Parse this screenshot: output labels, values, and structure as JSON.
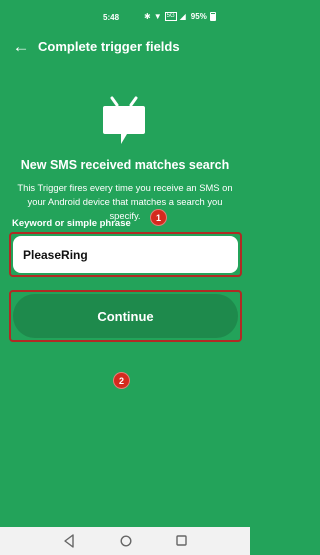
{
  "status_bar": {
    "time": "5:48",
    "bluetooth_glyph": "✱",
    "wifi_glyph": "▼",
    "signal_glyph": "◢",
    "network_label": "5G",
    "battery_percent": "95%",
    "battery_level": 0.95
  },
  "app_bar": {
    "back_icon": "arrow-left-icon",
    "back_glyph": "←",
    "title": "Complete trigger fields"
  },
  "trigger": {
    "service_icon": "sms-icon",
    "heading": "New SMS received matches search",
    "description": "This Trigger fires every time you receive an SMS on your Android device that matches a search you specify."
  },
  "field": {
    "label": "Keyword or simple phrase",
    "value": "PleaseRing",
    "annotation": "1"
  },
  "continue": {
    "label": "Continue",
    "annotation": "2"
  },
  "colors": {
    "background": "#23a35a",
    "button": "#1e8a4c",
    "annotation_red": "#d42a1e",
    "nav_bar": "#f2f2f2"
  },
  "nav_bar": {
    "items": [
      "back-triangle-icon",
      "home-circle-icon",
      "recents-square-icon"
    ]
  }
}
